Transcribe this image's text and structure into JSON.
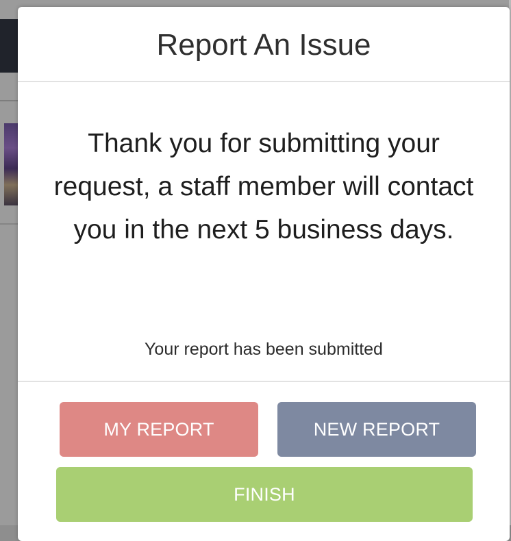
{
  "modal": {
    "title": "Report An Issue",
    "message": "Thank you for submitting your request, a staff member will contact you in the next 5 business days.",
    "status": "Your report has been submitted"
  },
  "buttons": {
    "my_report": "MY REPORT",
    "new_report": "NEW REPORT",
    "finish": "FINISH"
  },
  "colors": {
    "my_report": "#de8885",
    "new_report": "#7e89a1",
    "finish": "#a9cf73",
    "overlay": "#8e8e8e"
  }
}
